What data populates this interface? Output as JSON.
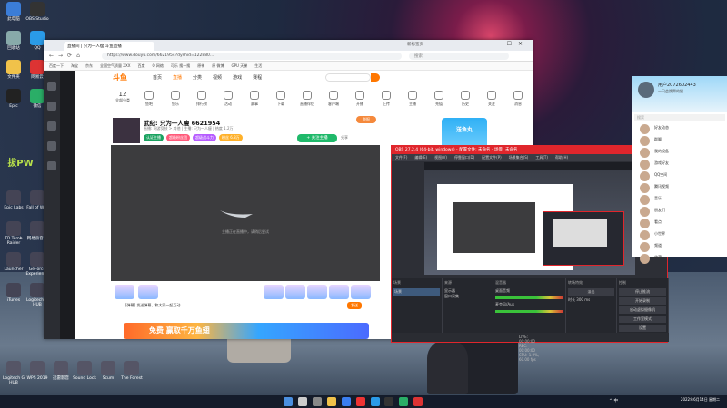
{
  "desktop": {
    "icons_left": [
      {
        "label": "此电脑",
        "color": "#3b7dd8"
      },
      {
        "label": "OBS Studio",
        "color": "#333"
      },
      {
        "label": "回收站",
        "color": "#8aa"
      },
      {
        "label": "QQ",
        "color": "#2a9be8"
      },
      {
        "label": "文件夹",
        "color": "#f0c24a"
      },
      {
        "label": "网易云",
        "color": "#d33"
      },
      {
        "label": "Epic",
        "color": "#222"
      },
      {
        "label": "微信",
        "color": "#2aae67"
      }
    ],
    "left_labels": [
      "Epic Labs",
      "Fall of War",
      "TR Tomb Raider",
      "网易云音乐",
      "Launcher",
      "GeForce Experience",
      "iTunes",
      "Logitech G HUB"
    ],
    "bottom_labels": [
      "Logitech G HUB",
      "WPS 2019",
      "迅雷影音",
      "Sound Lock",
      "Scum",
      "The Forest"
    ],
    "brand_text": "拔PW"
  },
  "browser": {
    "tab_title": "直播间 | 只为一人瘦 斗鱼直播",
    "tab2_title": "新标签页",
    "url": "https://www.douyu.com/6621954?dyshid=122880...",
    "search_placeholder": "搜索",
    "bookmarks": [
      "百度一下",
      "淘宝",
      "京东",
      "全国空气质量 XXX",
      "百度",
      "Q 网络",
      "可乐 搜一搜",
      "原神",
      "原 微博",
      "GPU 天梯",
      "生活"
    ],
    "site": {
      "logo": "斗鱼",
      "nav": [
        "首页",
        "直播",
        "分类",
        "视频",
        "游戏",
        "赛程"
      ],
      "categories": [
        {
          "label": "全部分类",
          "value": "12"
        },
        {
          "label": "鱼吧"
        },
        {
          "label": "鱼乐"
        },
        {
          "label": "排行榜"
        },
        {
          "label": "活动"
        },
        {
          "label": "赛事"
        },
        {
          "label": "下载"
        },
        {
          "label": "直播伴侣"
        },
        {
          "label": "客户端"
        },
        {
          "label": "开播"
        },
        {
          "label": "上传"
        },
        {
          "label": "主播"
        },
        {
          "label": "充值"
        },
        {
          "label": "历史"
        },
        {
          "label": "关注"
        },
        {
          "label": "消息"
        }
      ],
      "room_title": "武纪: 只为一人瘦 6621954",
      "room_sub": "直播: 网游竞技 > 其他 | 主播: 只为一人瘦 | 热度 1.2万",
      "badges": [
        {
          "text": "认证主播",
          "color": "#1aa260"
        },
        {
          "text": "超级粉丝团",
          "color": "#ff5a7a"
        },
        {
          "text": "超级战斗力",
          "color": "#b65cff"
        },
        {
          "text": "粉丝 6.8万",
          "color": "#ffb12a"
        }
      ],
      "follow_label": "+ 关注主播",
      "share_label": "分享",
      "report_label": "举报",
      "promo_label": "送鱼丸",
      "player_message": "主播正在直播中，请稍后尝试",
      "chat_placeholder": "[弹幕] 发送弹幕，和大家一起互动",
      "send_label": "发送",
      "banner_text": "免费 赢取千万鱼翅"
    }
  },
  "obs": {
    "title": "OBS 27.2.4 (64-bit, windows) - 配置文件: 未命名 - 场景: 未命名",
    "menu": [
      "文件(F)",
      "编辑(E)",
      "视图(V)",
      "停靠窗口(D)",
      "配置文件(P)",
      "场景集合(S)",
      "工具(T)",
      "帮助(H)"
    ],
    "panes": {
      "scenes_title": "场景",
      "scene_item": "场景",
      "sources_title": "来源",
      "sources": [
        "显示器",
        "窗口采集"
      ],
      "mixer_title": "混音器",
      "mixer_items": [
        "桌面音频",
        "麦克风/Aux"
      ],
      "transition_title": "转场特效",
      "transition_value": "淡出",
      "duration_label": "时长",
      "duration_value": "300 ms",
      "controls_title": "控制",
      "controls": [
        "停止推流",
        "开始录制",
        "启动虚拟摄像机",
        "工作室模式",
        "设置",
        "退出"
      ]
    },
    "status": "LIVE: 00:00:00   REC: 00:00:00   CPU: 1.9%, 60.00 fps"
  },
  "qq": {
    "name": "用户2072602443",
    "signature": "一只会跳舞的猫",
    "search_placeholder": "搜索",
    "tabs": [
      "消息",
      "联系人",
      "空间"
    ],
    "rows": [
      "好友动态",
      "群聊",
      "我的设备",
      "游戏好友",
      "QQ空间",
      "腾讯视频",
      "音乐",
      "朋友们",
      "看点",
      "小世界",
      "频道",
      "收藏"
    ]
  },
  "taskbar": {
    "time": "2022年6月14日 星期二",
    "tray": "^ 中"
  }
}
